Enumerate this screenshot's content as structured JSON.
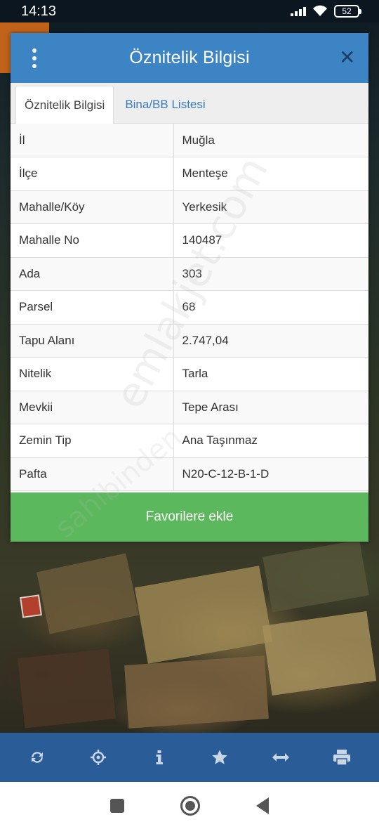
{
  "status_bar": {
    "time": "14:13",
    "battery": "52",
    "icons": [
      "signal-icon",
      "wifi-icon",
      "battery-icon"
    ]
  },
  "dialog": {
    "title": "Öznitelik Bilgisi",
    "menu_icon": "vertical-dots-icon",
    "close_icon": "close-icon",
    "tabs": [
      {
        "label": "Öznitelik Bilgisi",
        "active": true
      },
      {
        "label": "Bina/BB Listesi",
        "active": false
      }
    ],
    "rows": [
      {
        "key": "İl",
        "value": "Muğla"
      },
      {
        "key": "İlçe",
        "value": "Menteşe"
      },
      {
        "key": "Mahalle/Köy",
        "value": "Yerkesik"
      },
      {
        "key": "Mahalle No",
        "value": "140487"
      },
      {
        "key": "Ada",
        "value": "303"
      },
      {
        "key": "Parsel",
        "value": "68"
      },
      {
        "key": "Tapu Alanı",
        "value": "2.747,04"
      },
      {
        "key": "Nitelik",
        "value": "Tarla"
      },
      {
        "key": "Mevkii",
        "value": "Tepe Arası"
      },
      {
        "key": "Zemin Tip",
        "value": "Ana Taşınmaz"
      },
      {
        "key": "Pafta",
        "value": "N20-C-12-B-1-D"
      }
    ],
    "favorite_button": "Favorilere ekle"
  },
  "watermark": {
    "text": "emlakjet.com",
    "text2": "sahibinden"
  },
  "toolbar": {
    "tools": [
      "refresh-icon",
      "crosshair-icon",
      "info-icon",
      "star-icon",
      "measure-icon",
      "print-icon"
    ]
  },
  "colors": {
    "header": "#3c84c4",
    "favorite_button": "#5cb85c",
    "toolbar": "#2a5d97",
    "tab_link": "#3a7cb8"
  }
}
